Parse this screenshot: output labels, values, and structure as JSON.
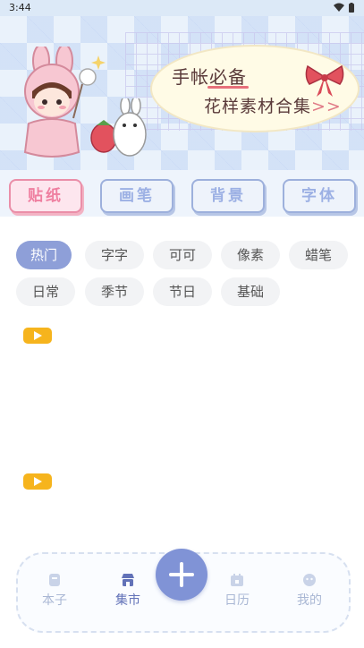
{
  "status": {
    "time": "3:44",
    "icons": [
      "wifi-icon",
      "battery-icon"
    ]
  },
  "banner": {
    "title_line1": "手帐必备",
    "title_line2": "花样素材合集",
    "arrows": ">>"
  },
  "tools": [
    {
      "label": "贴纸",
      "active": true
    },
    {
      "label": "画笔",
      "active": false
    },
    {
      "label": "背景",
      "active": false
    },
    {
      "label": "字体",
      "active": false
    }
  ],
  "categories": [
    {
      "label": "热门",
      "active": true
    },
    {
      "label": "字字"
    },
    {
      "label": "可可"
    },
    {
      "label": "像素"
    },
    {
      "label": "蜡笔"
    },
    {
      "label": "日常"
    },
    {
      "label": "季节"
    },
    {
      "label": "节日"
    },
    {
      "label": "基础"
    }
  ],
  "tabbar": {
    "items": [
      {
        "label": "本子",
        "icon": "notebook-icon"
      },
      {
        "label": "集市",
        "icon": "shop-icon",
        "active": true
      },
      {
        "label": "日历",
        "icon": "calendar-icon"
      },
      {
        "label": "我的",
        "icon": "profile-icon"
      }
    ],
    "add_icon": "plus-icon"
  },
  "colors": {
    "accent": "#8e9fd8",
    "active_pink": "#ef7fa0",
    "play": "#f6b41d"
  }
}
